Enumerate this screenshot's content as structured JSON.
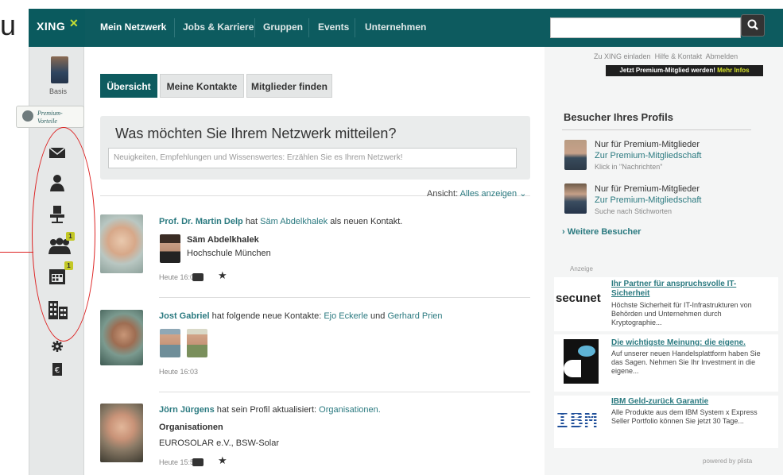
{
  "page": {
    "overlay_letter": "u"
  },
  "brand": {
    "logo": "XING",
    "logo_mark": "^X"
  },
  "nav": {
    "items": [
      "Mein Netzwerk",
      "Jobs & Karriere",
      "Gruppen",
      "Events",
      "Unternehmen"
    ]
  },
  "sidebar": {
    "profile_label": "Basis",
    "premium": {
      "line1": "Premium-",
      "line2": "Vorteile"
    },
    "badges": {
      "contacts": "1",
      "events": "1"
    },
    "icons": [
      "mail-icon",
      "profile-icon",
      "jobs-icon",
      "contacts-icon",
      "calendar-icon",
      "companies-icon",
      "settings-icon",
      "billing-icon"
    ]
  },
  "tabs": [
    "Übersicht",
    "Meine Kontakte",
    "Mitglieder finden"
  ],
  "post": {
    "question": "Was möchten Sie Ihrem Netzwerk mitteilen?",
    "placeholder": "Neuigkeiten, Empfehlungen und Wissenswertes: Erzählen Sie es Ihrem Netzwerk!"
  },
  "filter": {
    "label": "Ansicht:",
    "value": "Alles anzeigen"
  },
  "feed": [
    {
      "actor": "Prof. Dr. Martin Delp",
      "verb": "hat",
      "object": "Säm Abdelkhalek",
      "tail": "als neuen Kontakt.",
      "contact_name": "Säm Abdelkhalek",
      "contact_org": "Hochschule München",
      "time": "Heute 16:03"
    },
    {
      "actor": "Jost Gabriel",
      "verb": "hat folgende neue Kontakte:",
      "object": "Ejo Eckerle",
      "conj": "und",
      "object2": "Gerhard Prien",
      "time": "Heute 16:03"
    },
    {
      "actor": "Jörn Jürgens",
      "verb": "hat sein Profil aktualisiert:",
      "object": "Organisationen.",
      "section": "Organisationen",
      "detail": "EUROSOLAR e.V., BSW-Solar",
      "time": "Heute 15:56"
    }
  ],
  "right": {
    "links": [
      "Zu XING einladen",
      "Hilfe & Kontakt",
      "Abmelden"
    ],
    "premium_cta": "Jetzt Premium-Mitglied werden!",
    "premium_more": "Mehr Infos",
    "visitors_title": "Besucher Ihres Profils",
    "visitors": [
      {
        "line1": "Nur für Premium-Mitglieder",
        "link": "Zur Premium-Mitgliedschaft",
        "hint": "Klick in \"Nachrichten\""
      },
      {
        "line1": "Nur für Premium-Mitglieder",
        "link": "Zur Premium-Mitgliedschaft",
        "hint": "Suche nach Stichworten"
      }
    ],
    "more_visitors": "Weitere Besucher",
    "ads_label": "Anzeige",
    "ads": [
      {
        "logo": "secunet",
        "title": "Ihr Partner für anspruchsvolle IT-Sicherheit",
        "text": "Höchste Sicherheit für IT-Infrastrukturen von Behörden und Unternehmen durch Kryptographie..."
      },
      {
        "title": "Die wichtigste Meinung: die eigene.",
        "text": "Auf unserer neuen Handelsplattform haben Sie das Sagen. Nehmen Sie Ihr Investment in die eigene..."
      },
      {
        "logo": "IBM",
        "title": "IBM Geld-zurück Garantie",
        "text": "Alle Produkte aus dem IBM System x Express Seller Portfolio können Sie jetzt 30 Tage..."
      }
    ],
    "powered_by": "powered by plista"
  },
  "colors": {
    "nav_bg": "#0d5b5f",
    "link": "#2b7a80",
    "annotation": "#d22222",
    "badge": "#c3c826"
  }
}
